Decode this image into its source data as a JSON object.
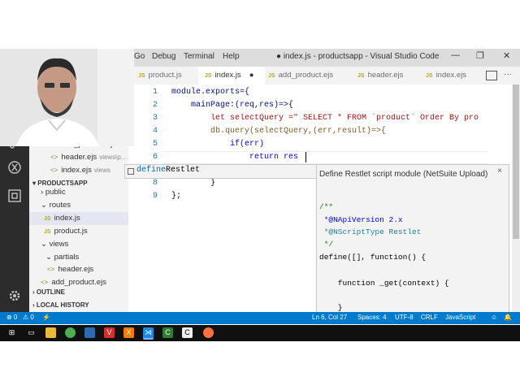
{
  "window": {
    "title": "● index.js - productsapp - Visual Studio Code",
    "menu": [
      "Go",
      "Debug",
      "Terminal",
      "Help"
    ],
    "controls": [
      "—",
      "❐",
      "✕"
    ]
  },
  "tabs": [
    {
      "badge": "JS",
      "label": "product.js",
      "modified": "",
      "active": false
    },
    {
      "badge": "JS",
      "label": "index.js",
      "modified": "●",
      "active": true
    },
    {
      "badge": "JS",
      "label": "add_product.ejs",
      "modified": "",
      "active": false
    },
    {
      "badge": "JS",
      "label": "header.ejs",
      "modified": "",
      "active": false
    },
    {
      "badge": "JS",
      "label": "index.ejs",
      "modified": "",
      "active": false
    }
  ],
  "sidebar": {
    "open_editors": [
      {
        "label": "add_product.ejs",
        "hint": "v..."
      },
      {
        "label": "header.ejs",
        "hint": "views\\p..."
      },
      {
        "label": "index.ejs",
        "hint": "views"
      }
    ],
    "project_header": "PRODUCTSAPP",
    "tree": [
      {
        "label": "public",
        "kind": "folder"
      },
      {
        "label": "routes",
        "kind": "folder"
      },
      {
        "label": "index.js",
        "kind": "js"
      },
      {
        "label": "product.js",
        "kind": "js"
      },
      {
        "label": "views",
        "kind": "folder"
      },
      {
        "label": "partials",
        "kind": "folder"
      },
      {
        "label": "header.ejs",
        "kind": "ejs"
      },
      {
        "label": "add_product.ejs",
        "kind": "ejs"
      }
    ],
    "outline": "OUTLINE",
    "local_history": "LOCAL HISTORY"
  },
  "editor": {
    "line_numbers": [
      "1",
      "2",
      "3",
      "4",
      "5",
      "6",
      "7",
      "8",
      "9"
    ],
    "lines": [
      "module.exports={",
      "    mainPage:(req,res)=>{",
      "        let selectQuery =\" SELECT * FROM `product` Order By pro",
      "        db.query(selectQuery,(err,result)=>{",
      "            if(err)",
      "                return res",
      "",
      "        }",
      "};"
    ]
  },
  "suggest": {
    "match": "define",
    "rest": "Restlet"
  },
  "details": {
    "title": "Define Restlet script module (NetSuite Upload)",
    "close": "×",
    "code": [
      "/**",
      " *@NApiVersion 2.x",
      " *@NScriptType Restlet",
      " */",
      "define([], function() {",
      "",
      "    function _get(context) {",
      "",
      "    }"
    ]
  },
  "status": {
    "errors": "⊗ 0",
    "warnings": "⚠ 0",
    "position": "Ln 6, Col 27",
    "spaces": "Spaces: 4",
    "encoding": "UTF-8",
    "eol": "CRLF",
    "language": "JavaScript"
  },
  "colors": {
    "statusbar": "#007acc",
    "activitybar": "#2c2c2c",
    "sidebar": "#f3f3f3",
    "keyword": "#0000ff",
    "string": "#a31515"
  },
  "taskbar_icons": [
    "windows-icon",
    "search-icon",
    "task-view-icon",
    "file-explorer-icon",
    "chrome-icon",
    "firefox-icon",
    "vivaldi-icon",
    "xampp-icon",
    "vscode-icon",
    "camtasia-icon",
    "command-icon",
    "firefox-dev-icon"
  ]
}
